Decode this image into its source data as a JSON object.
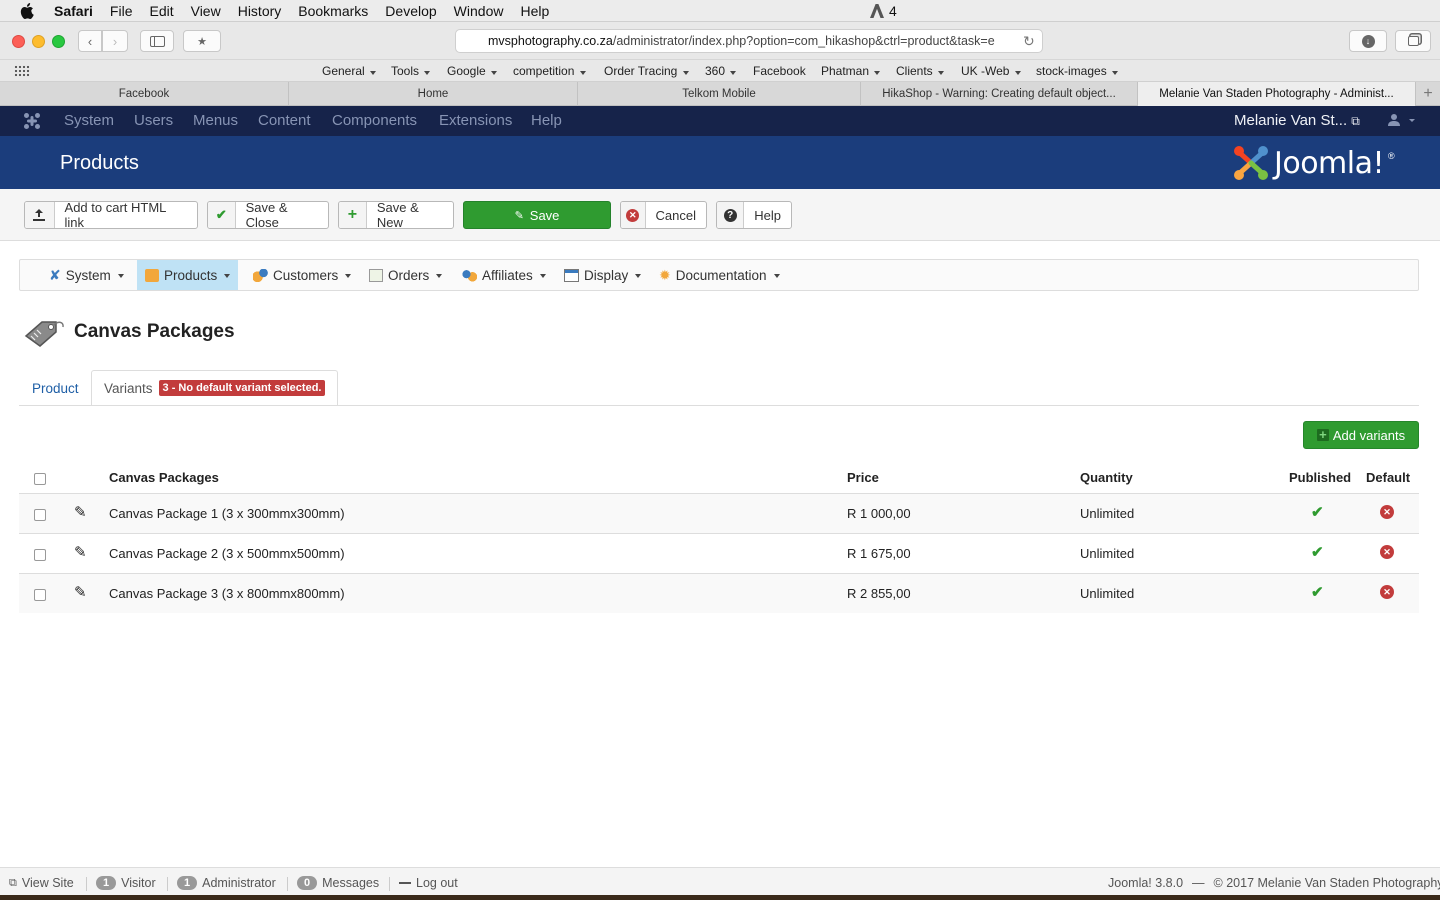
{
  "mac_menu": {
    "app": "Safari",
    "items": [
      "File",
      "Edit",
      "View",
      "History",
      "Bookmarks",
      "Develop",
      "Window",
      "Help"
    ],
    "status_number": "4"
  },
  "browser": {
    "url_host": "mvsphotography.co.za",
    "url_rest": "/administrator/index.php?option=com_hikashop&ctrl=product&task=e",
    "favorites": [
      "General",
      "Tools",
      "Google",
      "competition",
      "Order Tracing",
      "360",
      "Facebook",
      "Phatman",
      "Clients",
      "UK -Web",
      "stock-images"
    ],
    "tabs": [
      "Facebook",
      "Home",
      "Telkom Mobile",
      "HikaShop - Warning: Creating default object...",
      "Melanie Van Staden Photography - Administ..."
    ]
  },
  "joomla_nav": {
    "items": [
      "System",
      "Users",
      "Menus",
      "Content",
      "Components",
      "Extensions",
      "Help"
    ],
    "user": "Melanie Van St..."
  },
  "header": {
    "title": "Products",
    "logo_text": "Joomla!"
  },
  "toolbar": {
    "add_cart": "Add to cart HTML link",
    "save_close": "Save & Close",
    "save_new": "Save & New",
    "save": "Save",
    "cancel": "Cancel",
    "help": "Help"
  },
  "hika_menu": [
    "System",
    "Products",
    "Customers",
    "Orders",
    "Affiliates",
    "Display",
    "Documentation"
  ],
  "page": {
    "title": "Canvas Packages",
    "tab_product": "Product",
    "tab_variants": "Variants",
    "variants_badge": "3 - No default variant selected.",
    "add_variants": "Add variants"
  },
  "table": {
    "headers": {
      "name": "Canvas Packages",
      "price": "Price",
      "quantity": "Quantity",
      "published": "Published",
      "default": "Default"
    },
    "rows": [
      {
        "name": "Canvas Package 1 (3 x 300mmx300mm)",
        "price": "R 1 000,00",
        "quantity": "Unlimited"
      },
      {
        "name": "Canvas Package 2 (3 x 500mmx500mm)",
        "price": "R 1 675,00",
        "quantity": "Unlimited"
      },
      {
        "name": "Canvas Package 3 (3 x 800mmx800mm)",
        "price": "R 2 855,00",
        "quantity": "Unlimited"
      }
    ]
  },
  "footer": {
    "view_site": "View Site",
    "visitor_count": "1",
    "visitor": "Visitor",
    "admin_count": "1",
    "admin": "Administrator",
    "messages_count": "0",
    "messages": "Messages",
    "logout": "Log out",
    "version": "Joomla! 3.8.0",
    "copyright": "© 2017 Melanie Van Staden Photography",
    "sep": "—"
  },
  "colors": {
    "joomla_dark": "#16234a",
    "joomla_header": "#1b3d7c",
    "save_green": "#2f9b30",
    "badge_red": "#c23c3c",
    "link_blue": "#1f5fa6"
  }
}
